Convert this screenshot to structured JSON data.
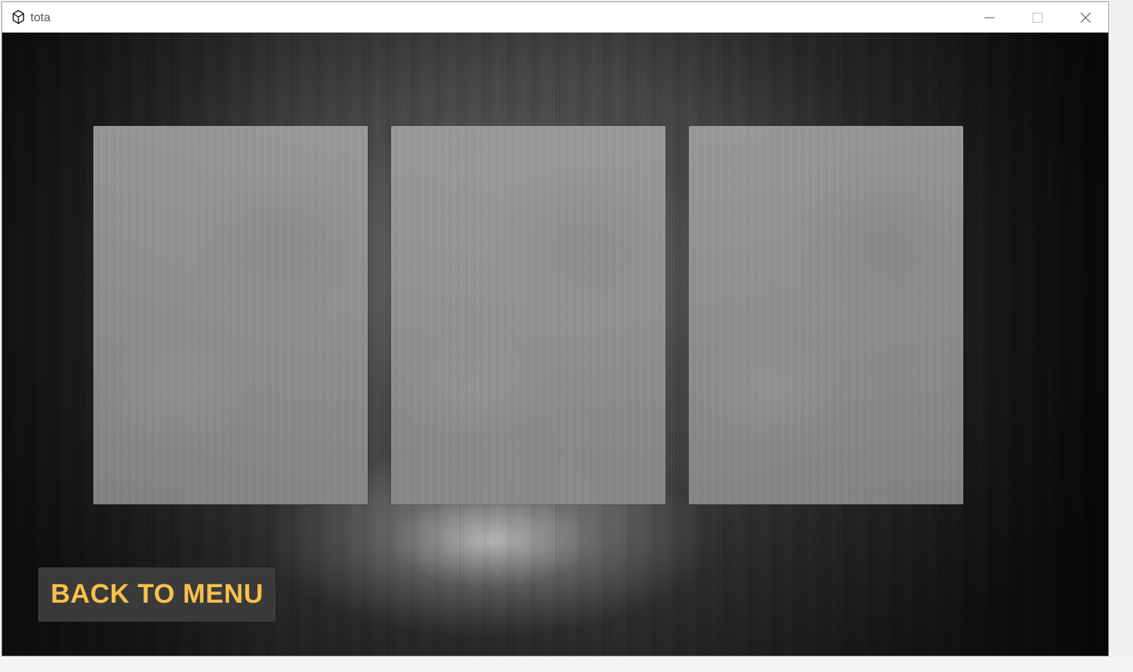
{
  "window": {
    "title": "tota",
    "app_icon": "unity-icon",
    "controls": {
      "minimize_icon": "minimize-icon",
      "maximize_icon": "maximize-icon",
      "close_icon": "close-icon"
    }
  },
  "game": {
    "cards": [
      {
        "id": "card-1"
      },
      {
        "id": "card-2"
      },
      {
        "id": "card-3"
      }
    ],
    "back_button": {
      "label": "BACK TO MENU",
      "text_color": "#f7c04a",
      "background": "#3a3a3a"
    }
  }
}
